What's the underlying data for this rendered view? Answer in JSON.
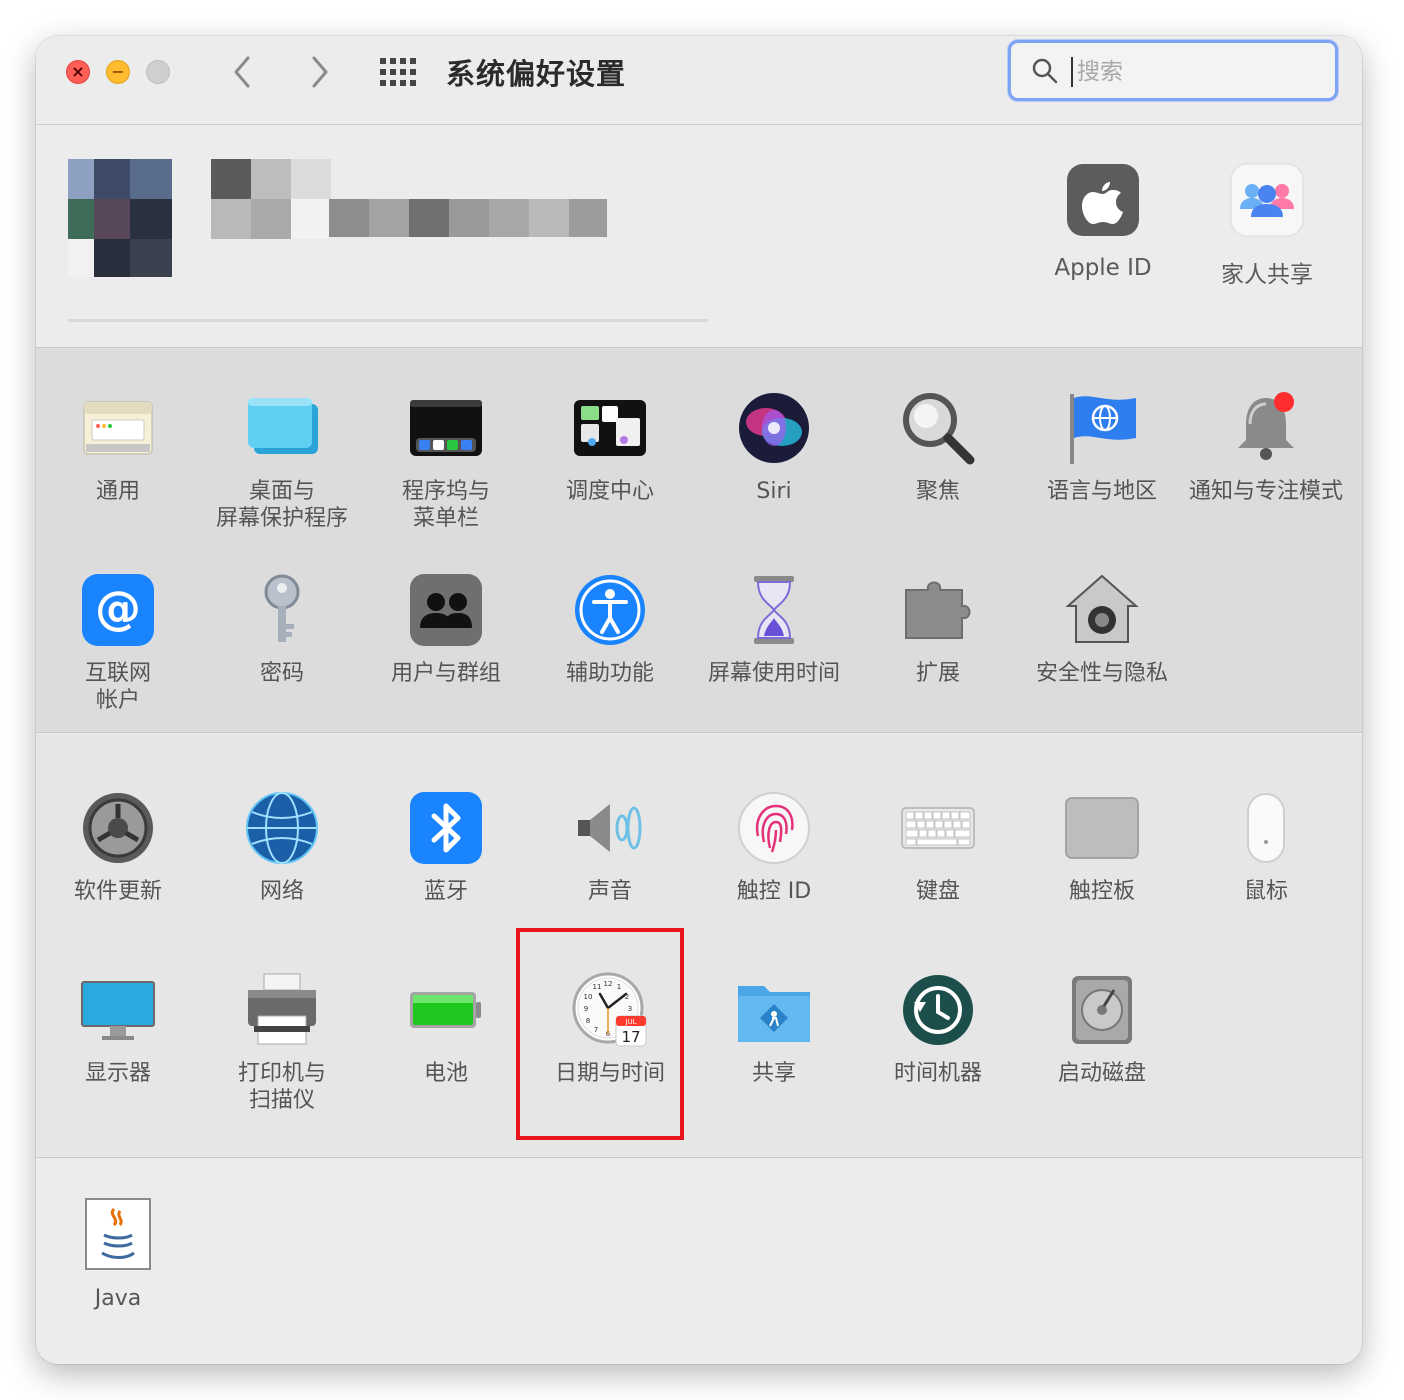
{
  "window": {
    "title": "系统偏好设置",
    "search_placeholder": "搜索"
  },
  "account": {
    "items": [
      {
        "label": "Apple ID",
        "icon": "apple-logo-icon"
      },
      {
        "label": "家人共享",
        "icon": "family-sharing-icon"
      }
    ]
  },
  "panes_row1": [
    {
      "label": "通用",
      "icon": "general-icon"
    },
    {
      "label": "桌面与\n屏幕保护程序",
      "icon": "desktop-screensaver-icon"
    },
    {
      "label": "程序坞与\n菜单栏",
      "icon": "dock-menubar-icon"
    },
    {
      "label": "调度中心",
      "icon": "mission-control-icon"
    },
    {
      "label": "Siri",
      "icon": "siri-icon"
    },
    {
      "label": "聚焦",
      "icon": "spotlight-icon"
    },
    {
      "label": "语言与地区",
      "icon": "language-region-icon"
    },
    {
      "label": "通知与专注模式",
      "icon": "notifications-icon"
    }
  ],
  "panes_row2": [
    {
      "label": "互联网\n帐户",
      "icon": "internet-accounts-icon"
    },
    {
      "label": "密码",
      "icon": "passwords-icon"
    },
    {
      "label": "用户与群组",
      "icon": "users-groups-icon"
    },
    {
      "label": "辅助功能",
      "icon": "accessibility-icon"
    },
    {
      "label": "屏幕使用时间",
      "icon": "screen-time-icon"
    },
    {
      "label": "扩展",
      "icon": "extensions-icon"
    },
    {
      "label": "安全性与隐私",
      "icon": "security-privacy-icon"
    }
  ],
  "panes_row3": [
    {
      "label": "软件更新",
      "icon": "software-update-icon"
    },
    {
      "label": "网络",
      "icon": "network-icon"
    },
    {
      "label": "蓝牙",
      "icon": "bluetooth-icon"
    },
    {
      "label": "声音",
      "icon": "sound-icon"
    },
    {
      "label": "触控 ID",
      "icon": "touch-id-icon"
    },
    {
      "label": "键盘",
      "icon": "keyboard-icon"
    },
    {
      "label": "触控板",
      "icon": "trackpad-icon"
    },
    {
      "label": "鼠标",
      "icon": "mouse-icon"
    }
  ],
  "panes_row4": [
    {
      "label": "显示器",
      "icon": "displays-icon"
    },
    {
      "label": "打印机与\n扫描仪",
      "icon": "printers-scanners-icon"
    },
    {
      "label": "电池",
      "icon": "battery-icon"
    },
    {
      "label": "日期与时间",
      "icon": "date-time-icon"
    },
    {
      "label": "共享",
      "icon": "sharing-icon"
    },
    {
      "label": "时间机器",
      "icon": "time-machine-icon"
    },
    {
      "label": "启动磁盘",
      "icon": "startup-disk-icon"
    }
  ],
  "panes_other": [
    {
      "label": "Java",
      "icon": "java-icon"
    }
  ],
  "highlight": {
    "color": "#e8141c",
    "target": "日期与时间"
  },
  "colors": {
    "accent": "#7ea4f5",
    "close": "#ff5f57",
    "minimize": "#febc2e"
  }
}
